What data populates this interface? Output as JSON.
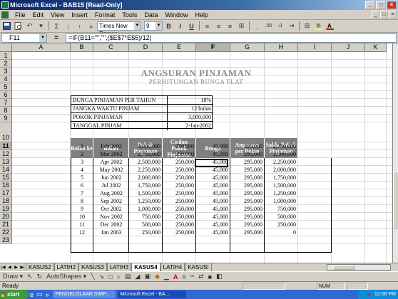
{
  "window": {
    "title": "Microsoft Excel - BAB15  [Read-Only]",
    "btn_min": "_",
    "btn_max": "□",
    "btn_close": "×"
  },
  "menu": [
    "File",
    "Edit",
    "View",
    "Insert",
    "Format",
    "Tools",
    "Data",
    "Window",
    "Help"
  ],
  "toolbar": {
    "font_name": "Times New Roman",
    "font_size": "9",
    "bold": "B",
    "italic": "I",
    "underline": "U",
    "comma": ",",
    "dec_inc": ".00",
    "dec_dec": ".0"
  },
  "formula_bar": {
    "name_box": "F11",
    "fx": "=",
    "formula": "=IF(B11=\"\",\"\",($E$7*E$5)/12)"
  },
  "columns": [
    "A",
    "B",
    "C",
    "D",
    "E",
    "F",
    "G",
    "H",
    "I",
    "J",
    "K"
  ],
  "active_column": "F",
  "rows": [
    "1",
    "2",
    "3",
    "4",
    "5",
    "6",
    "7",
    "8",
    "9",
    "10",
    "11",
    "12",
    "13",
    "14",
    "15",
    "16",
    "17",
    "18",
    "19",
    "20",
    "21",
    "22",
    "23"
  ],
  "active_row": "11",
  "sheet": {
    "title": "ANGSURAN PINJAMAN",
    "subtitle": "PERHITUNGAN BUNGA FLAT",
    "info": [
      {
        "label": "BUNGA PINJAMAN PER TAHUN",
        "value": "18%"
      },
      {
        "label": "JANGKA WAKTU PINJAM",
        "value": "12 bulan"
      },
      {
        "label": "POKOK PINJAMAN",
        "value": "3,000,000"
      },
      {
        "label": "TANGGAL PINJAM",
        "value": "2-Jan-2002"
      }
    ],
    "table_headers": [
      "Bulan ke",
      "Bulan",
      "Pokok Pinjaman",
      "Cicilan Pokok Pinjaman",
      "Bunga",
      "Angsuran per Bulan",
      "Saldo Pokok Pinjaman"
    ],
    "table_rows": [
      [
        "1",
        "Feb 2002",
        "3,000,000",
        "250,000",
        "45,000",
        "295,000",
        "2,750,000"
      ],
      [
        "2",
        "Mar 2002",
        "2,750,000",
        "250,000",
        "45,000",
        "295,000",
        "2,500,000"
      ],
      [
        "3",
        "Apr 2002",
        "2,500,000",
        "250,000",
        "45,000",
        "295,000",
        "2,250,000"
      ],
      [
        "4",
        "May 2002",
        "2,250,000",
        "250,000",
        "45,000",
        "295,000",
        "2,000,000"
      ],
      [
        "5",
        "Jun 2002",
        "2,000,000",
        "250,000",
        "45,000",
        "295,000",
        "1,750,000"
      ],
      [
        "6",
        "Jul 2002",
        "1,750,000",
        "250,000",
        "45,000",
        "295,000",
        "1,500,000"
      ],
      [
        "7",
        "Aug 2002",
        "1,500,000",
        "250,000",
        "45,000",
        "295,000",
        "1,250,000"
      ],
      [
        "8",
        "Sep 2002",
        "1,250,000",
        "250,000",
        "45,000",
        "295,000",
        "1,000,000"
      ],
      [
        "9",
        "Oct 2002",
        "1,000,000",
        "250,000",
        "45,000",
        "295,000",
        "750,000"
      ],
      [
        "10",
        "Nov 2002",
        "750,000",
        "250,000",
        "45,000",
        "295,000",
        "500,000"
      ],
      [
        "11",
        "Dec 2002",
        "500,000",
        "250,000",
        "45,000",
        "295,000",
        "250,000"
      ],
      [
        "12",
        "Jan 2003",
        "250,000",
        "250,000",
        "45,000",
        "295,000",
        "0"
      ]
    ]
  },
  "sheet_tabs": [
    "KASUS2",
    "LATIH2",
    "KASUS3",
    "LATIH3",
    "KASUS4",
    "LATIH4",
    "KASUS!"
  ],
  "active_tab": "KASUS4",
  "draw_toolbar": {
    "draw": "Draw ▾",
    "autoshapes": "AutoShapes ▾"
  },
  "status": {
    "text": "Ready",
    "num": "NUM"
  },
  "taskbar": {
    "start": "start",
    "tasks": [
      "PENGELOLAAN SIMP...",
      "Microsoft Excel - BA..."
    ],
    "clock": "12:06 PM",
    "quicklaunch": "»"
  }
}
